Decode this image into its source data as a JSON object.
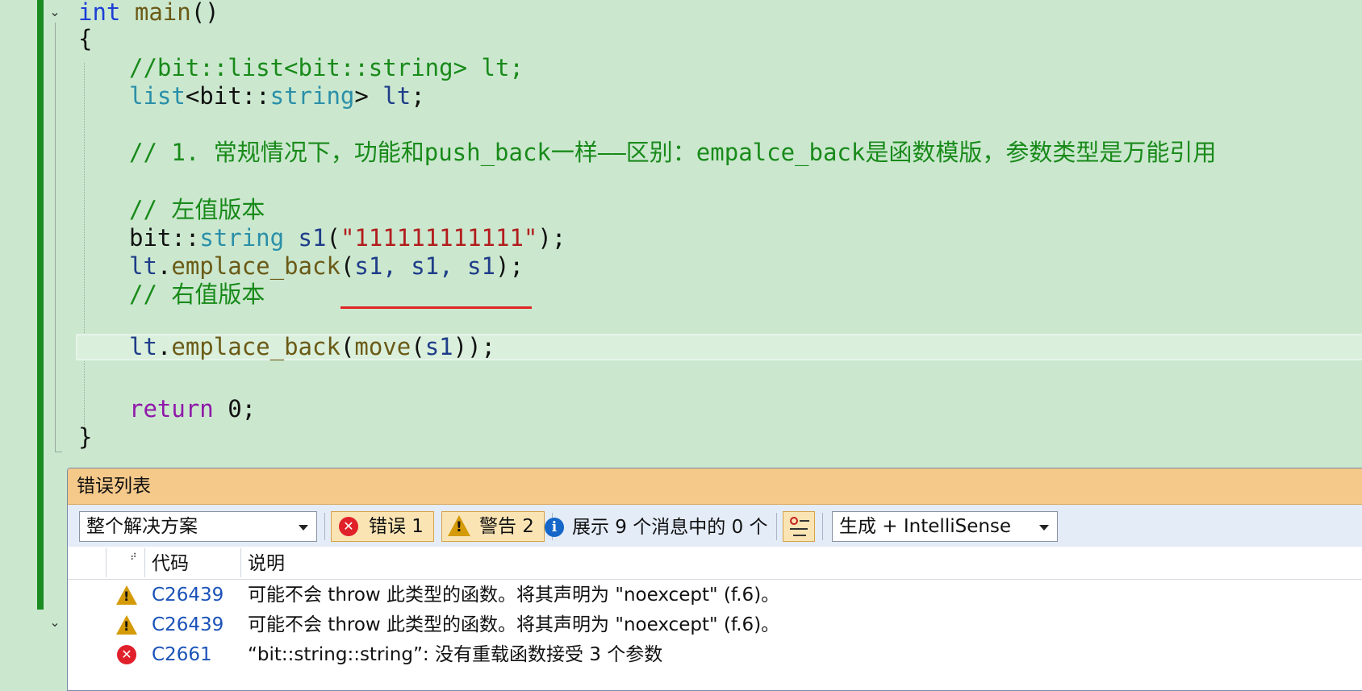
{
  "editor": {
    "lines": {
      "l1_kw": "int",
      "l1_fn": "main",
      "l1_rest": "()",
      "l2": "{",
      "l3": "//bit::list<bit::string> lt;",
      "l4_ty": "list",
      "l4_a": "<bit::",
      "l4_ty2": "string",
      "l4_b": "> ",
      "l4_var": "lt",
      "l4_end": ";",
      "l6": "// 1. 常规情况下，功能和push_back一样——区别：empalce_back是函数模版，参数类型是万能引用",
      "l8": "// 左值版本",
      "l9_ns": "bit::",
      "l9_ty": "string",
      "l9_var": " s1",
      "l9_open": "(",
      "l9_str": "\"111111111111\"",
      "l9_close": ");",
      "l10_var": "lt",
      "l10_dot": ".",
      "l10_fn": "emplace_back",
      "l10_open": "(",
      "l10_args": "s1, s1, s1",
      "l10_close": ");",
      "l11": "// 右值版本",
      "l12_var": "lt",
      "l12_dot": ".",
      "l12_fn": "emplace_back",
      "l12_open": "(",
      "l12_fn2": "move",
      "l12_open2": "(",
      "l12_arg": "s1",
      "l12_close": "));",
      "l14_kw": "return",
      "l14_rest": " 0;",
      "l15": "}"
    }
  },
  "error_list": {
    "title": "错误列表",
    "scope_combo": "整个解决方案",
    "errors_btn": "错误 1",
    "warnings_btn": "警告 2",
    "messages_text": "展示 9 个消息中的 0 个",
    "source_combo": "生成 + IntelliSense",
    "columns": {
      "code": "代码",
      "description": "说明"
    },
    "rows": [
      {
        "severity": "warning",
        "code": "C26439",
        "description": "可能不会 throw 此类型的函数。将其声明为 \"noexcept\" (f.6)。"
      },
      {
        "severity": "warning",
        "code": "C26439",
        "description": "可能不会 throw 此类型的函数。将其声明为 \"noexcept\" (f.6)。"
      },
      {
        "severity": "error",
        "code": "C2661",
        "description": "“bit::string::string”: 没有重载函数接受 3 个参数"
      }
    ]
  },
  "icons": {
    "fold": "chevron-down-icon",
    "error": "error-circle-icon",
    "warning": "warning-triangle-icon",
    "info": "info-circle-icon",
    "filter": "filter-icon",
    "sort": "sort-icon"
  }
}
